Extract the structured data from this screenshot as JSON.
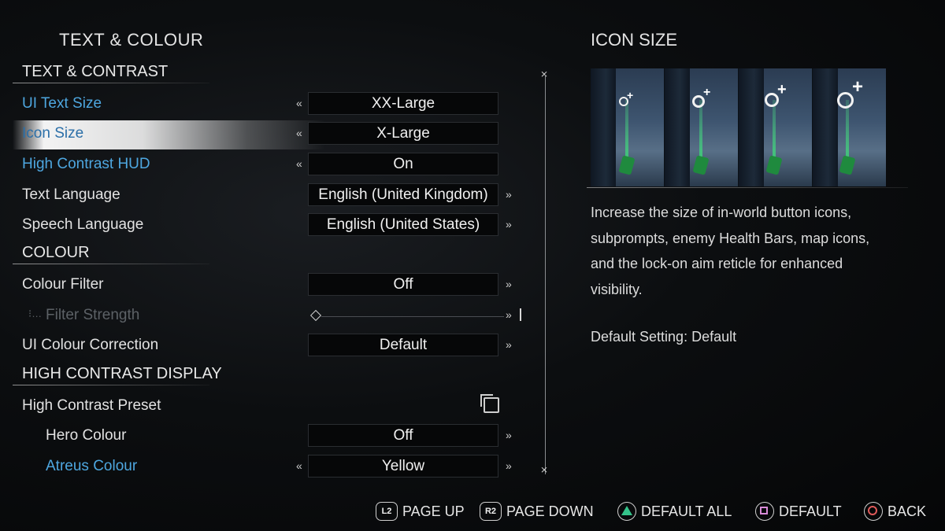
{
  "page": {
    "title": "TEXT & COLOUR"
  },
  "sections": {
    "text_contrast": "TEXT & CONTRAST",
    "colour": "COLOUR",
    "high_contrast_display": "HIGH CONTRAST DISPLAY"
  },
  "settings": {
    "ui_text_size": {
      "label": "UI Text Size",
      "value": "XX-Large"
    },
    "icon_size": {
      "label": "Icon Size",
      "value": "X-Large"
    },
    "high_contrast_hud": {
      "label": "High Contrast HUD",
      "value": "On"
    },
    "text_language": {
      "label": "Text Language",
      "value": "English (United Kingdom)"
    },
    "speech_language": {
      "label": "Speech Language",
      "value": "English (United States)"
    },
    "colour_filter": {
      "label": "Colour Filter",
      "value": "Off"
    },
    "filter_strength": {
      "label": "Filter Strength",
      "value_fraction": 0.0
    },
    "ui_colour_correction": {
      "label": "UI Colour Correction",
      "value": "Default"
    },
    "high_contrast_preset": {
      "label": "High Contrast Preset"
    },
    "hero_colour": {
      "label": "Hero Colour",
      "value": "Off"
    },
    "atreus_colour": {
      "label": "Atreus Colour",
      "value": "Yellow"
    }
  },
  "glyphs": {
    "left_arrow": "«",
    "right_arrow": "»",
    "sub_indent": "⁝…",
    "divider_cap": "⨯"
  },
  "panel": {
    "title": "ICON SIZE",
    "description": "Increase the size of in-world button icons, subprompts, enemy Health Bars, map icons, and the lock-on aim reticle for enhanced visibility.",
    "default_setting": "Default Setting: Default"
  },
  "footer": {
    "page_up": {
      "badge": "L2",
      "label": "PAGE UP"
    },
    "page_down": {
      "badge": "R2",
      "label": "PAGE DOWN"
    },
    "default_all": {
      "label": "DEFAULT ALL"
    },
    "default": {
      "label": "DEFAULT"
    },
    "back": {
      "label": "BACK"
    }
  },
  "colors": {
    "accent_blue": "#4ea7e0",
    "selected_label": "#2b6fa8"
  }
}
